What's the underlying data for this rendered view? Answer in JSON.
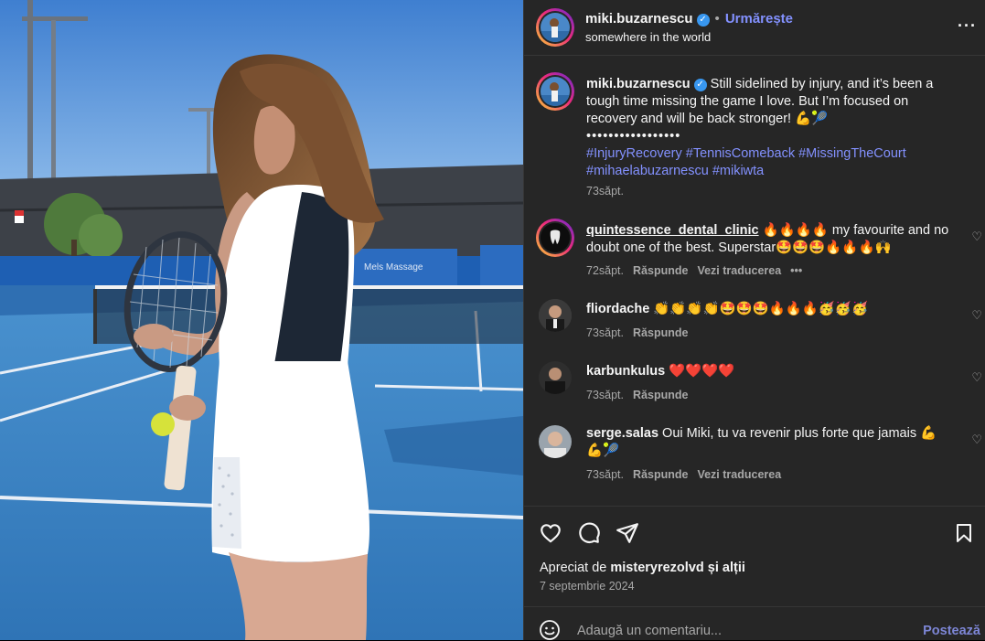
{
  "post": {
    "username": "miki.buzarnescu",
    "follow_label": "Urmărește",
    "location": "somewhere in the world"
  },
  "caption": {
    "username": "miki.buzarnescu",
    "text": "Still sidelined by injury, and it’s been a tough time missing the game I love. But I’m focused on recovery and will be back stronger! 💪🎾",
    "dots": "•••••••••••••••••",
    "hashtags": "#InjuryRecovery #TennisComeback #MissingTheCourt #mihaelabuzarnescu #mikiwta",
    "time": "73săpt."
  },
  "comments": [
    {
      "username": "quintessence_dental_clinic",
      "text": "🔥🔥🔥🔥 my favourite and no doubt one of the best. Superstar🤩🤩🤩🔥🔥🔥🙌",
      "time": "72săpt.",
      "reply": "Răspunde",
      "translate": "Vezi traducerea"
    },
    {
      "username": "fliordache",
      "text": "👏👏👏👏🤩🤩🤩🔥🔥🔥🥳🥳🥳",
      "time": "73săpt.",
      "reply": "Răspunde"
    },
    {
      "username": "karbunkulus",
      "text": "❤️❤️❤️❤️",
      "time": "73săpt.",
      "reply": "Răspunde"
    },
    {
      "username": "serge.salas",
      "text": "Oui Miki, tu va revenir plus forte que jamais 💪💪🎾",
      "time": "73săpt.",
      "reply": "Răspunde",
      "translate": "Vezi traducerea"
    }
  ],
  "likes": {
    "prefix": "Apreciat de",
    "user": "misteryrezolvd",
    "suffix": "și alții"
  },
  "date": "7 septembrie 2024",
  "add_comment": {
    "placeholder": "Adaugă un comentariu...",
    "post_label": "Postează"
  },
  "photo": {
    "banner_text": "Mels Massage"
  },
  "colors": {
    "link": "#8391ff",
    "panel_bg": "#262626",
    "court_blue": "#3b82c4"
  }
}
